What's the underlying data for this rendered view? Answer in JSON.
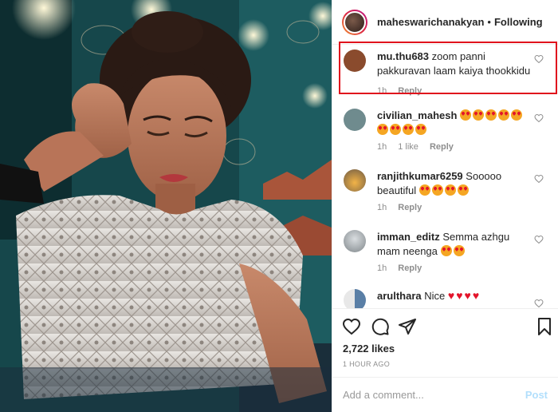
{
  "header": {
    "username": "maheswarichanakyan",
    "separator": "•",
    "follow_status": "Following"
  },
  "comments": [
    {
      "user": "mu.thu683",
      "text": "zoom panni pakkuravan laam kaiya thookkidu",
      "time": "1h",
      "likes": "",
      "reply": "Reply",
      "avatar_color": "#8a4b2d",
      "emoji": []
    },
    {
      "user": "civilian_mahesh",
      "text": "",
      "time": "1h",
      "likes": "1 like",
      "reply": "Reply",
      "avatar_color": "#6f8b8e",
      "emoji": [
        "heart-eyes",
        "heart-eyes",
        "heart-eyes",
        "heart-eyes",
        "heart-eyes",
        "heart-eyes",
        "heart-eyes",
        "heart-eyes",
        "heart-eyes"
      ]
    },
    {
      "user": "ranjithkumar6259",
      "text": "Sooooo beautiful",
      "time": "1h",
      "likes": "",
      "reply": "Reply",
      "avatar_color": "#c08a3a",
      "emoji": [
        "heart-eyes",
        "heart-eyes",
        "heart-eyes",
        "heart-eyes"
      ]
    },
    {
      "user": "imman_editz",
      "text": "Semma azhgu mam neenga",
      "time": "1h",
      "likes": "",
      "reply": "Reply",
      "avatar_color": "#9aa3a8",
      "emoji": [
        "heart-eyes",
        "heart-eyes"
      ]
    },
    {
      "user": "arulthara",
      "text": "Nice",
      "time": "",
      "likes": "",
      "reply": "",
      "avatar_color": "#5a7fa6",
      "emoji": [
        "red-heart",
        "red-heart",
        "red-heart",
        "red-heart"
      ]
    }
  ],
  "actions": {
    "likes": "2,722 likes",
    "time_ago": "1 HOUR AGO"
  },
  "add_comment": {
    "placeholder": "Add a comment...",
    "post_label": "Post"
  },
  "icons": {
    "like": "heart-outline-icon",
    "comment": "comment-bubble-icon",
    "share": "paper-plane-icon",
    "save": "bookmark-icon",
    "comment_like": "small-heart-icon"
  },
  "colors": {
    "highlight_border": "#e0131d",
    "post_button": "#b2dffc",
    "secondary_text": "#8e8e8e"
  }
}
